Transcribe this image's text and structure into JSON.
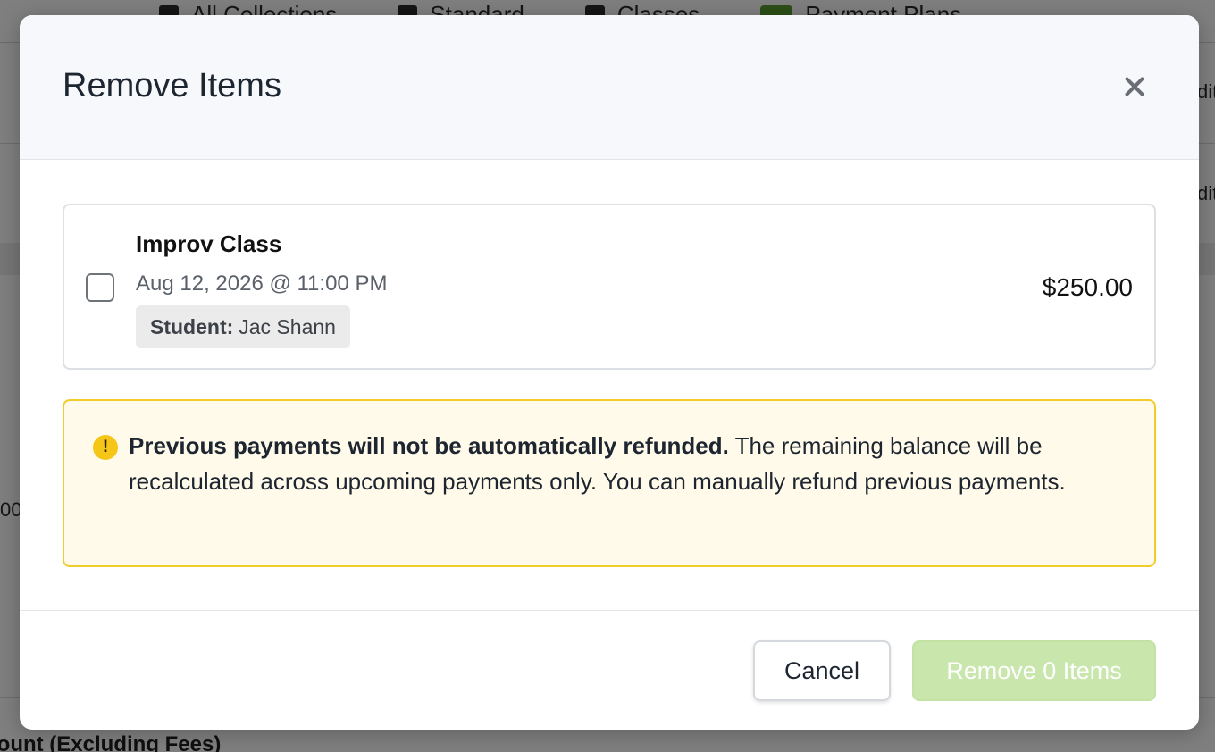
{
  "background": {
    "tabs": [
      {
        "label": "All Collections",
        "icon": "collections-icon"
      },
      {
        "label": "Standard",
        "icon": "dollar-icon"
      },
      {
        "label": "Classes",
        "icon": "graduation-cap-icon"
      },
      {
        "label": "Payment Plans",
        "icon": "payment-plan-icon"
      }
    ],
    "edge_text_1": "dit",
    "edge_text_2": "dit",
    "edge_text_3": "00",
    "footer_text": "nount (Excluding Fees)"
  },
  "modal": {
    "title": "Remove Items",
    "close_icon": "close-icon",
    "items": [
      {
        "name": "Improv Class",
        "date": "Aug 12, 2026 @ 11:00 PM",
        "student_label": "Student:",
        "student_name": "Jac Shann",
        "price": "$250.00",
        "checked": false
      }
    ],
    "warning": {
      "icon": "exclamation-icon",
      "bold": "Previous payments will not be automatically refunded.",
      "text": " The remaining balance will be recalculated across upcoming payments only. You can manually refund previous payments."
    },
    "cancel_label": "Cancel",
    "remove_label": "Remove 0 Items"
  },
  "colors": {
    "overlay": "rgba(0,0,0,0.5)",
    "warning_bg": "#fffaea",
    "warning_border": "#f2cc2b",
    "remove_disabled": "#c9e7ad"
  }
}
